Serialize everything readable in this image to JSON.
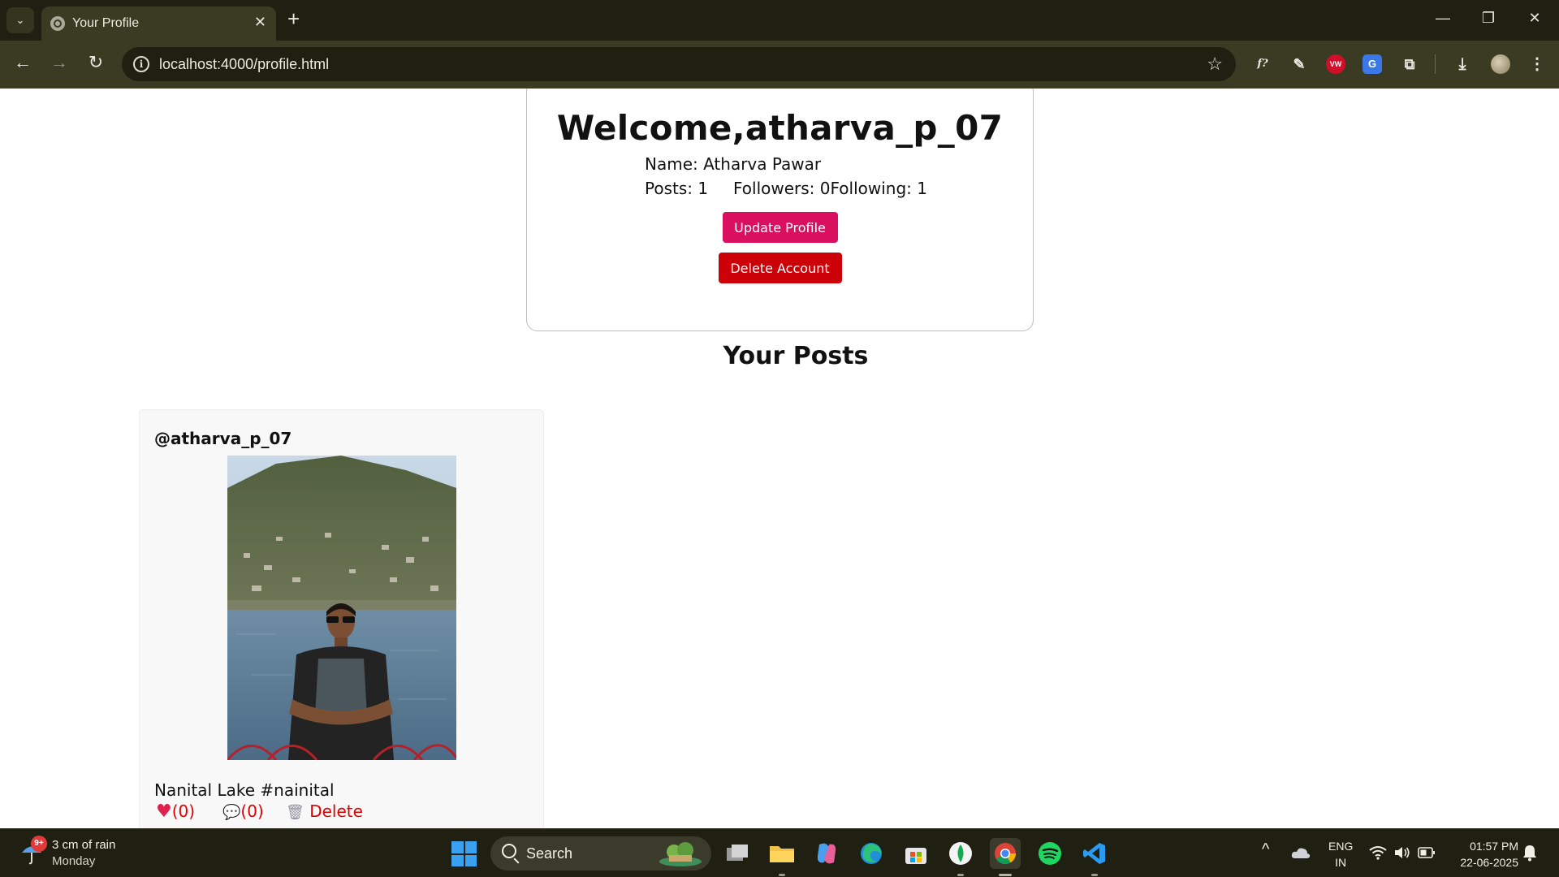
{
  "browser": {
    "tab_title": "Your Profile",
    "url": "localhost:4000/profile.html",
    "tab_list_glyph": "⌄",
    "close_tab_glyph": "✕",
    "new_tab_glyph": "+",
    "back_glyph": "←",
    "forward_glyph": "→",
    "reload_glyph": "↻",
    "info_glyph": "i",
    "star_glyph": "☆",
    "minimize_glyph": "—",
    "restore_glyph": "❐",
    "close_window_glyph": "✕",
    "extensions": [
      {
        "name": "fontface-ninja-icon",
        "glyph": "f?",
        "color": "#e8e8e0"
      },
      {
        "name": "color-picker-icon",
        "glyph": "✎",
        "color": "#e8e8e0"
      },
      {
        "name": "vw-extension-icon",
        "glyph": "VW",
        "color": "#ffffff",
        "bg": "#d0102a"
      },
      {
        "name": "translate-icon",
        "glyph": "G",
        "color": "#ffffff",
        "bg": "#3b78e7"
      },
      {
        "name": "extensions-puzzle-icon",
        "glyph": "⧉",
        "color": "#e8e8e0"
      },
      {
        "name": "download-icon",
        "glyph": "⤓",
        "color": "#e8e8e0"
      },
      {
        "name": "profile-avatar-icon",
        "glyph": "",
        "color": "#e8e8e0"
      },
      {
        "name": "menu-kebab-icon",
        "glyph": "⋮",
        "color": "#e8e8e0"
      }
    ]
  },
  "profile": {
    "welcome": "Welcome,atharva_p_07",
    "name_line": "Name: Atharva Pawar",
    "posts_line": "Posts: 1",
    "follow_line": "Followers: 0Following: 1",
    "update_button": "Update Profile",
    "delete_button": "Delete Account"
  },
  "posts_section": {
    "heading": "Your Posts",
    "posts": [
      {
        "username": "@atharva_p_07",
        "caption": "Nanital Lake #nainital",
        "likes": "(0)",
        "comments": "(0)",
        "delete_label": "Delete",
        "like_glyph": "♥",
        "comment_glyph": "💬",
        "delete_glyph": "🗑"
      }
    ]
  },
  "taskbar": {
    "weather_badge": "9+",
    "weather_main": "3 cm of rain",
    "weather_sub": "Monday",
    "search_label": "Search",
    "tray_chevron": "^",
    "lang_top": "ENG",
    "lang_bottom": "IN",
    "time": "01:57 PM",
    "date": "22-06-2025"
  },
  "colors": {
    "update_button": "#d9105f",
    "delete_button": "#cc0007",
    "action_red": "#e00000",
    "chrome_dark": "#1f2012",
    "chrome_toolbar": "#3a3b22"
  }
}
